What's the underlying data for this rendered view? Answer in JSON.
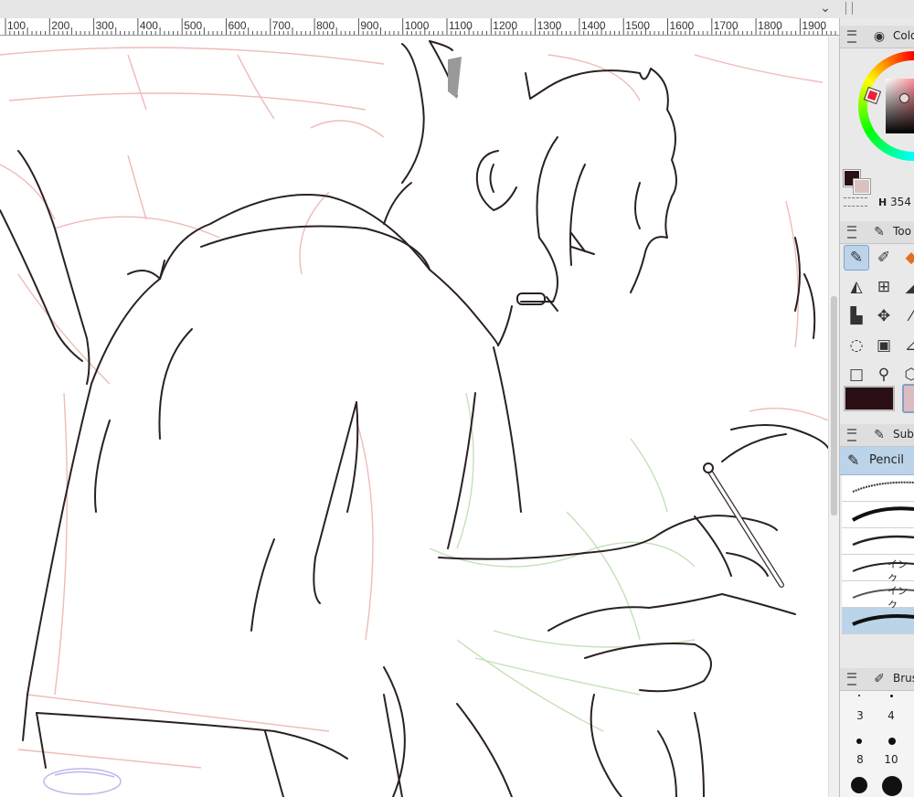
{
  "ruler": {
    "labels": [
      "100",
      "200",
      "300",
      "400",
      "500",
      "600",
      "700",
      "800",
      "900",
      "1000",
      "1100",
      "1200",
      "1300",
      "1400",
      "1500",
      "1600",
      "1700",
      "1800",
      "1900"
    ]
  },
  "topbar": {
    "collapse_icon": "chevron-down-icon"
  },
  "panels": {
    "color": {
      "title": "Colo",
      "hue_value_label": "H",
      "hue_value": "354",
      "main_color": "#2a1014",
      "sub_color": "#d9c1c0"
    },
    "tool": {
      "title": "Too",
      "main_color": "#2a1014",
      "sub_color": "#dcbcbf"
    },
    "subtool": {
      "title": "Sub",
      "selected": "Pencil",
      "brush_labels": [
        "インク",
        "インク"
      ]
    },
    "brush_size": {
      "title": "Brus",
      "sizes": [
        "3",
        "4",
        "8",
        "10"
      ]
    }
  },
  "colors": {
    "accent": "#bcd4ea",
    "ruler_bg": "#ffffff",
    "panel_bg": "#e9e9e9",
    "ink": "#2b2022",
    "sketch_red": "#e8a5a0",
    "sketch_green": "#b6d9a8"
  }
}
